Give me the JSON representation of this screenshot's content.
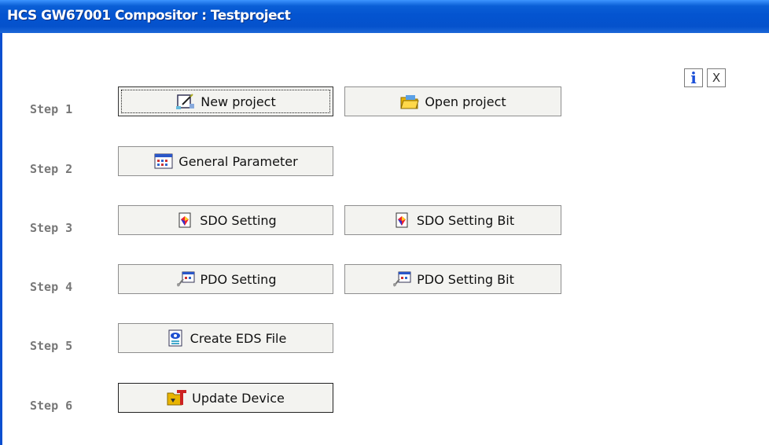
{
  "window": {
    "title": "HCS GW67001 Compositor : Testproject"
  },
  "toolbar": {
    "info_icon": "info-icon",
    "close_icon": "close-icon",
    "close_label": "X"
  },
  "steps": [
    {
      "label": "Step 1",
      "buttons": [
        {
          "label": "New project",
          "icon": "new-project-icon"
        },
        {
          "label": "Open project",
          "icon": "open-folder-icon"
        }
      ]
    },
    {
      "label": "Step 2",
      "buttons": [
        {
          "label": "General Parameter",
          "icon": "parameter-table-icon"
        }
      ]
    },
    {
      "label": "Step 3",
      "buttons": [
        {
          "label": "SDO Setting",
          "icon": "sdo-icon"
        },
        {
          "label": "SDO Setting Bit",
          "icon": "sdo-icon"
        }
      ]
    },
    {
      "label": "Step 4",
      "buttons": [
        {
          "label": "PDO Setting",
          "icon": "pdo-icon"
        },
        {
          "label": "PDO Setting Bit",
          "icon": "pdo-icon"
        }
      ]
    },
    {
      "label": "Step 5",
      "buttons": [
        {
          "label": "Create EDS File",
          "icon": "eds-file-icon"
        }
      ]
    },
    {
      "label": "Step 6",
      "buttons": [
        {
          "label": "Update Device",
          "icon": "update-device-icon"
        }
      ]
    }
  ]
}
